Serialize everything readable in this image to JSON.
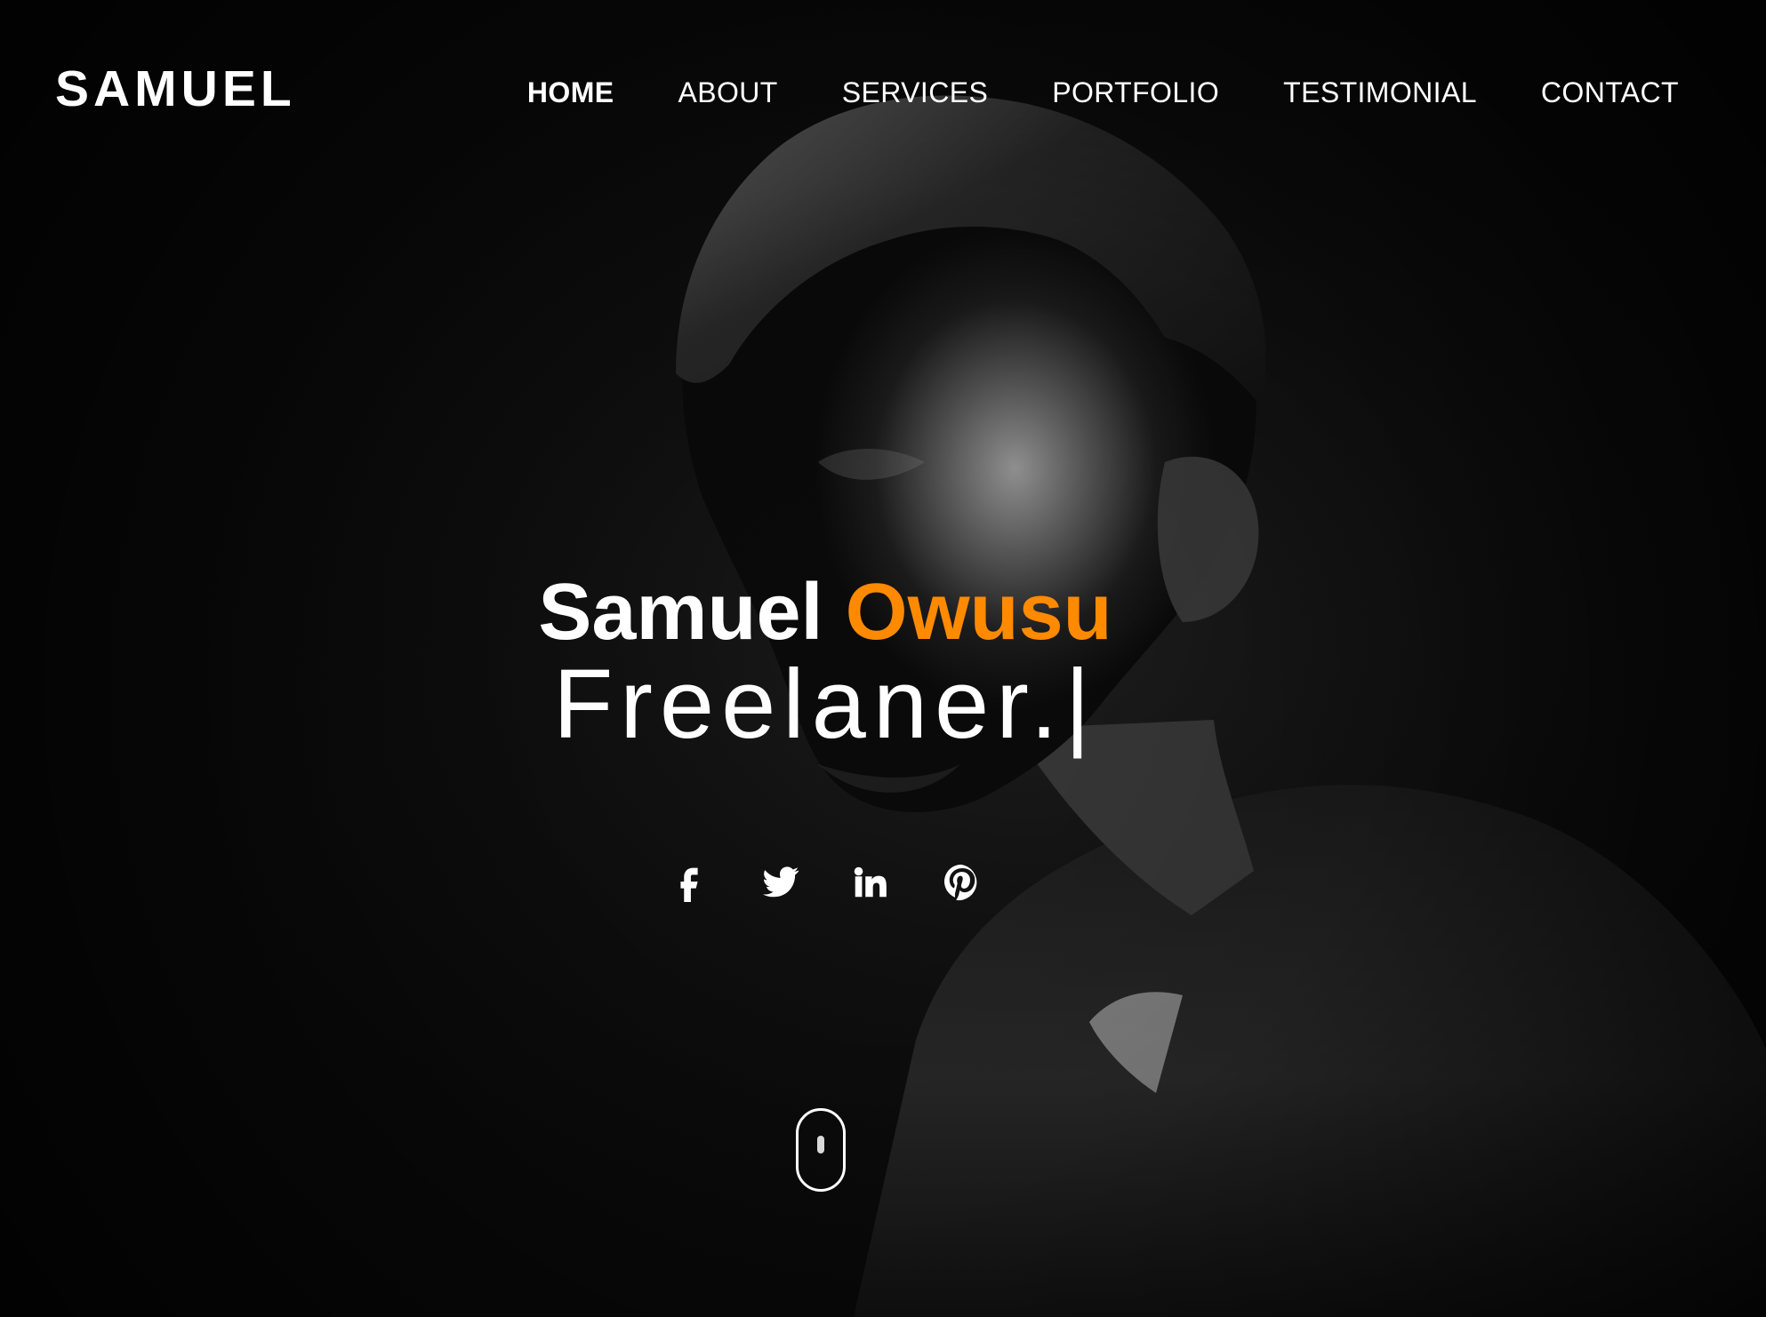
{
  "header": {
    "logo": "SAMUEL",
    "nav": {
      "home": "HOME",
      "about": "ABOUT",
      "services": "SERVICES",
      "portfolio": "PORTFOLIO",
      "testimonial": "TESTIMONIAL",
      "contact": "CONTACT"
    },
    "active_nav": "HOME"
  },
  "hero": {
    "first_name": "Samuel",
    "last_name": "Owusu",
    "role": "Freelaner.",
    "cursor": "|",
    "social_icons": [
      "facebook-icon",
      "twitter-icon",
      "linkedin-icon",
      "pinterest-icon"
    ],
    "scroll_indicator": "mouse-scroll-icon"
  },
  "colors": {
    "background": "#0a0a0a",
    "text": "#ffffff",
    "accent": "#ff8a00"
  }
}
